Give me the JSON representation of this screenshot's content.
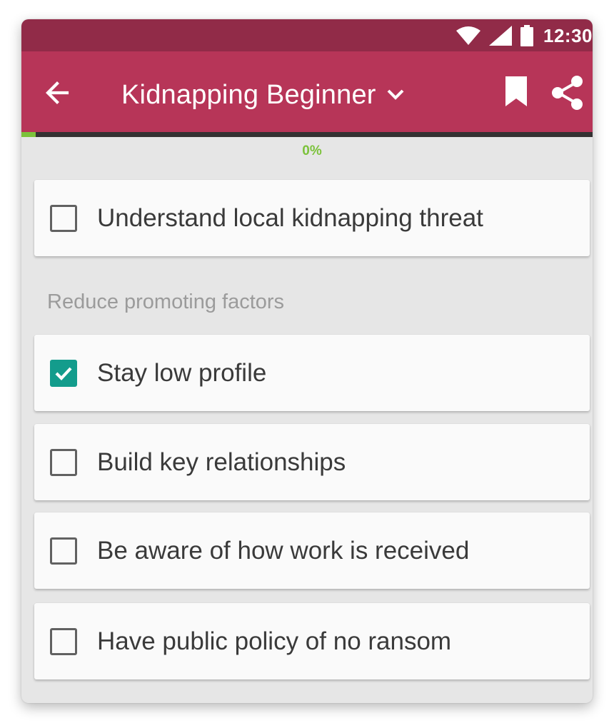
{
  "status_bar": {
    "time": "12:30",
    "wifi_icon": "wifi-icon",
    "signal_icon": "signal-icon",
    "battery_icon": "battery-icon"
  },
  "app_bar": {
    "back_icon": "arrow-back-icon",
    "title": "Kidnapping Beginner",
    "dropdown_icon": "chevron-down-icon",
    "bookmark_icon": "bookmark-icon",
    "share_icon": "share-icon"
  },
  "progress": {
    "label": "0%",
    "value": 0
  },
  "checklist": {
    "first_item": {
      "label": "Understand local kidnapping threat",
      "checked": false
    },
    "section": {
      "title": "Reduce promoting factors",
      "items": [
        {
          "label": "Stay low profile",
          "checked": true
        },
        {
          "label": "Build key relationships",
          "checked": false
        },
        {
          "label": "Be aware of how work is received",
          "checked": false
        },
        {
          "label": "Have public policy of no ransom",
          "checked": false
        }
      ]
    }
  },
  "colors": {
    "status_bar": "#912b48",
    "app_bar": "#b73558",
    "progress_track": "#343232",
    "progress_accent": "#7cc23b",
    "checkbox_checked": "#139c8c",
    "background": "#e6e6e6",
    "card": "#fafafa"
  }
}
